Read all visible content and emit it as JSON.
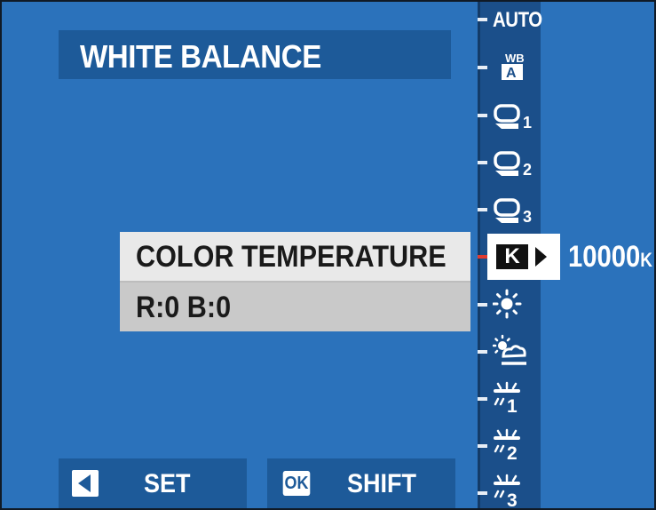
{
  "header": {
    "title": "WHITE BALANCE"
  },
  "menu": {
    "selected_label": "COLOR TEMPERATURE",
    "shift_label": "R:0  B:0"
  },
  "wb_strip": {
    "items": [
      {
        "id": "auto",
        "label": "AUTO",
        "icon": "auto-text"
      },
      {
        "id": "wb-a",
        "label": "WB A",
        "icon": "white-priority-icon"
      },
      {
        "id": "custom-1",
        "label": "1",
        "icon": "custom-wb-icon"
      },
      {
        "id": "custom-2",
        "label": "2",
        "icon": "custom-wb-icon"
      },
      {
        "id": "custom-3",
        "label": "3",
        "icon": "custom-wb-icon"
      },
      {
        "id": "kelvin",
        "label": "K",
        "icon": "kelvin-icon",
        "selected": true
      },
      {
        "id": "daylight",
        "label": "",
        "icon": "sun-icon"
      },
      {
        "id": "shade",
        "label": "",
        "icon": "shade-icon"
      },
      {
        "id": "fluor-1",
        "label": "1",
        "icon": "fluorescent-icon"
      },
      {
        "id": "fluor-2",
        "label": "2",
        "icon": "fluorescent-icon"
      },
      {
        "id": "fluor-3",
        "label": "3",
        "icon": "fluorescent-icon"
      }
    ],
    "wb_text": "WB",
    "wb_a_text": "A"
  },
  "kelvin": {
    "symbol": "K",
    "value": "10000",
    "unit": "K"
  },
  "footer": {
    "back_label": "SET",
    "ok_icon_text": "OK",
    "ok_label": "SHIFT"
  },
  "colors": {
    "background": "#2b72bb",
    "panel": "#1d5a99",
    "strip": "#1b4f8a",
    "menu_selected": "#e9e9e9",
    "menu_row": "#c9c9c9",
    "active_tick": "#e03a2f"
  }
}
